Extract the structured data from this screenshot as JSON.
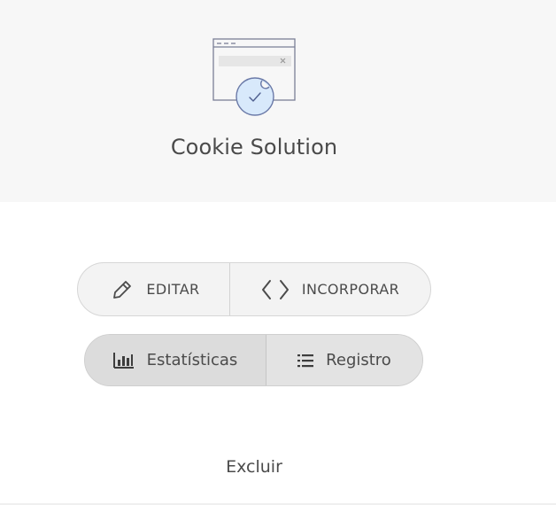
{
  "product": {
    "title": "Cookie Solution",
    "illustration_icon": "cookie-check-icon"
  },
  "actions_primary": {
    "edit_label": "EDITAR",
    "edit_icon": "pencil-icon",
    "embed_label": "INCORPORAR",
    "embed_icon": "code-icon"
  },
  "actions_secondary": {
    "stats_label": "Estatísticas",
    "stats_icon": "bar-chart-icon",
    "log_label": "Registro",
    "log_icon": "list-icon"
  },
  "delete_label": "Excluir",
  "colors": {
    "header_bg": "#f7f7f7",
    "cookie_fill": "#d8e9fb",
    "cookie_stroke": "#6b7aa8",
    "text": "#4b4b4b"
  }
}
